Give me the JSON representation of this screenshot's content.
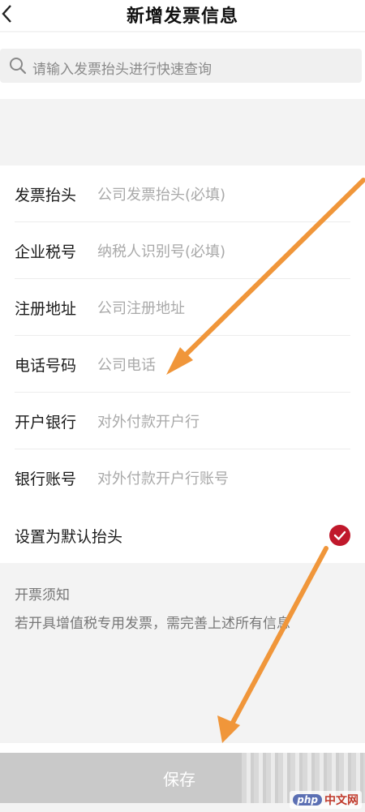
{
  "header": {
    "title": "新增发票信息",
    "back_icon": "chevron-left-icon"
  },
  "search": {
    "placeholder": "请输入发票抬头进行快速查询",
    "icon": "search-icon"
  },
  "form": {
    "rows": [
      {
        "label": "发票抬头",
        "placeholder": "公司发票抬头(必填)"
      },
      {
        "label": "企业税号",
        "placeholder": "纳税人识别号(必填)"
      },
      {
        "label": "注册地址",
        "placeholder": "公司注册地址"
      },
      {
        "label": "电话号码",
        "placeholder": "公司电话"
      },
      {
        "label": "开户银行",
        "placeholder": "对外付款开户行"
      },
      {
        "label": "银行账号",
        "placeholder": "对外付款开户行账号"
      }
    ],
    "default_toggle": {
      "label": "设置为默认抬头",
      "checked": true,
      "color": "#c0182b"
    }
  },
  "notice": {
    "title": "开票须知",
    "text": "若开具增值税专用发票，需完善上述所有信息"
  },
  "footer": {
    "save_label": "保存"
  },
  "watermark": {
    "logo": "php",
    "text": "中文网"
  },
  "colors": {
    "arrow": "#f0963a",
    "check": "#c0182b",
    "save_bg": "#c9c9c9"
  }
}
